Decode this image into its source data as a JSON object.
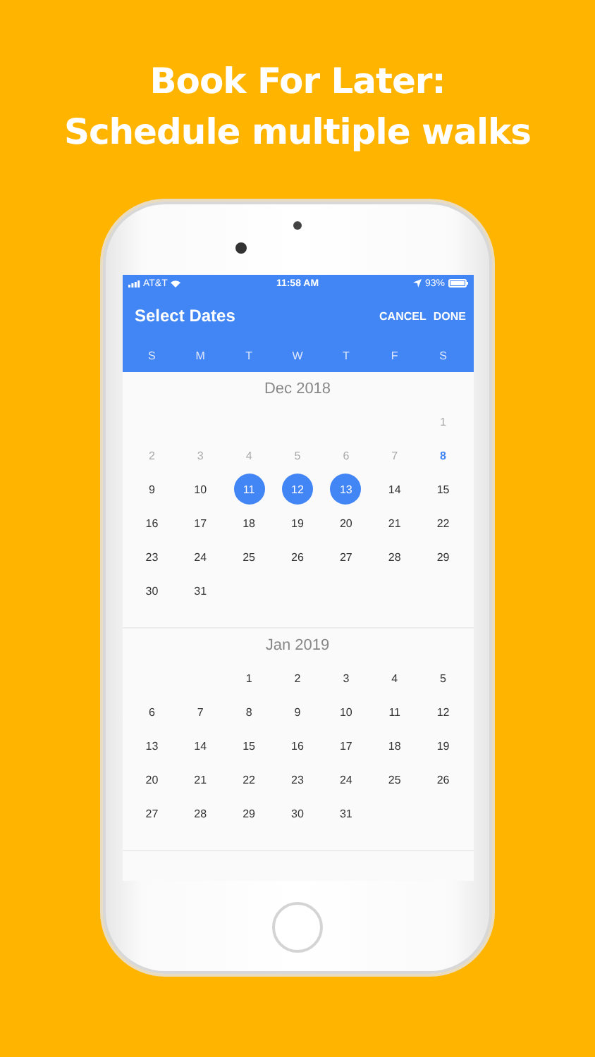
{
  "headline": [
    "Book For Later:",
    "Schedule multiple walks"
  ],
  "status_bar": {
    "carrier": "AT&T",
    "time": "11:58 AM",
    "battery": "93%"
  },
  "header": {
    "title": "Select Dates",
    "actions": [
      "CANCEL",
      "DONE"
    ]
  },
  "weekdays": [
    "S",
    "M",
    "T",
    "W",
    "T",
    "F",
    "S"
  ],
  "months": [
    {
      "title": "Dec 2018",
      "weeks": [
        {
          "kind": "first",
          "days": [
            {
              "label": "1",
              "kind": "past",
              "selected": false
            }
          ]
        },
        {
          "kind": "full",
          "days": [
            {
              "label": "2",
              "kind": "past",
              "selected": false
            },
            {
              "label": "3",
              "kind": "past",
              "selected": false
            },
            {
              "label": "4",
              "kind": "past",
              "selected": false
            },
            {
              "label": "5",
              "kind": "past",
              "selected": false
            },
            {
              "label": "6",
              "kind": "past",
              "selected": false
            },
            {
              "label": "7",
              "kind": "past",
              "selected": false
            },
            {
              "label": "8",
              "kind": "today",
              "selected": false
            }
          ]
        },
        {
          "kind": "full",
          "days": [
            {
              "label": "9",
              "kind": "normal",
              "selected": false
            },
            {
              "label": "10",
              "kind": "normal",
              "selected": false
            },
            {
              "label": "11",
              "kind": "normal",
              "selected": true
            },
            {
              "label": "12",
              "kind": "normal",
              "selected": true
            },
            {
              "label": "13",
              "kind": "normal",
              "selected": true
            },
            {
              "label": "14",
              "kind": "normal",
              "selected": false
            },
            {
              "label": "15",
              "kind": "normal",
              "selected": false
            }
          ]
        },
        {
          "kind": "full",
          "days": [
            {
              "label": "16",
              "kind": "normal",
              "selected": false
            },
            {
              "label": "17",
              "kind": "normal",
              "selected": false
            },
            {
              "label": "18",
              "kind": "normal",
              "selected": false
            },
            {
              "label": "19",
              "kind": "normal",
              "selected": false
            },
            {
              "label": "20",
              "kind": "normal",
              "selected": false
            },
            {
              "label": "21",
              "kind": "normal",
              "selected": false
            },
            {
              "label": "22",
              "kind": "normal",
              "selected": false
            }
          ]
        },
        {
          "kind": "full",
          "days": [
            {
              "label": "23",
              "kind": "normal",
              "selected": false
            },
            {
              "label": "24",
              "kind": "normal",
              "selected": false
            },
            {
              "label": "25",
              "kind": "normal",
              "selected": false
            },
            {
              "label": "26",
              "kind": "normal",
              "selected": false
            },
            {
              "label": "27",
              "kind": "normal",
              "selected": false
            },
            {
              "label": "28",
              "kind": "normal",
              "selected": false
            },
            {
              "label": "29",
              "kind": "normal",
              "selected": false
            }
          ]
        },
        {
          "kind": "last",
          "days": [
            {
              "label": "30",
              "kind": "normal",
              "selected": false
            },
            {
              "label": "31",
              "kind": "normal",
              "selected": false
            }
          ]
        }
      ]
    },
    {
      "title": "Jan 2019",
      "weeks": [
        {
          "kind": "first",
          "days": [
            {
              "label": "1",
              "kind": "normal",
              "selected": false
            },
            {
              "label": "2",
              "kind": "normal",
              "selected": false
            },
            {
              "label": "3",
              "kind": "normal",
              "selected": false
            },
            {
              "label": "4",
              "kind": "normal",
              "selected": false
            },
            {
              "label": "5",
              "kind": "normal",
              "selected": false
            }
          ]
        },
        {
          "kind": "full",
          "days": [
            {
              "label": "6",
              "kind": "normal",
              "selected": false
            },
            {
              "label": "7",
              "kind": "normal",
              "selected": false
            },
            {
              "label": "8",
              "kind": "normal",
              "selected": false
            },
            {
              "label": "9",
              "kind": "normal",
              "selected": false
            },
            {
              "label": "10",
              "kind": "normal",
              "selected": false
            },
            {
              "label": "11",
              "kind": "normal",
              "selected": false
            },
            {
              "label": "12",
              "kind": "normal",
              "selected": false
            }
          ]
        },
        {
          "kind": "full",
          "days": [
            {
              "label": "13",
              "kind": "normal",
              "selected": false
            },
            {
              "label": "14",
              "kind": "normal",
              "selected": false
            },
            {
              "label": "15",
              "kind": "normal",
              "selected": false
            },
            {
              "label": "16",
              "kind": "normal",
              "selected": false
            },
            {
              "label": "17",
              "kind": "normal",
              "selected": false
            },
            {
              "label": "18",
              "kind": "normal",
              "selected": false
            },
            {
              "label": "19",
              "kind": "normal",
              "selected": false
            }
          ]
        },
        {
          "kind": "full",
          "days": [
            {
              "label": "20",
              "kind": "normal",
              "selected": false
            },
            {
              "label": "21",
              "kind": "normal",
              "selected": false
            },
            {
              "label": "22",
              "kind": "normal",
              "selected": false
            },
            {
              "label": "23",
              "kind": "normal",
              "selected": false
            },
            {
              "label": "24",
              "kind": "normal",
              "selected": false
            },
            {
              "label": "25",
              "kind": "normal",
              "selected": false
            },
            {
              "label": "26",
              "kind": "normal",
              "selected": false
            }
          ]
        },
        {
          "kind": "last",
          "days": [
            {
              "label": "27",
              "kind": "normal",
              "selected": false
            },
            {
              "label": "28",
              "kind": "normal",
              "selected": false
            },
            {
              "label": "29",
              "kind": "normal",
              "selected": false
            },
            {
              "label": "30",
              "kind": "normal",
              "selected": false
            },
            {
              "label": "31",
              "kind": "normal",
              "selected": false
            }
          ]
        }
      ]
    }
  ]
}
